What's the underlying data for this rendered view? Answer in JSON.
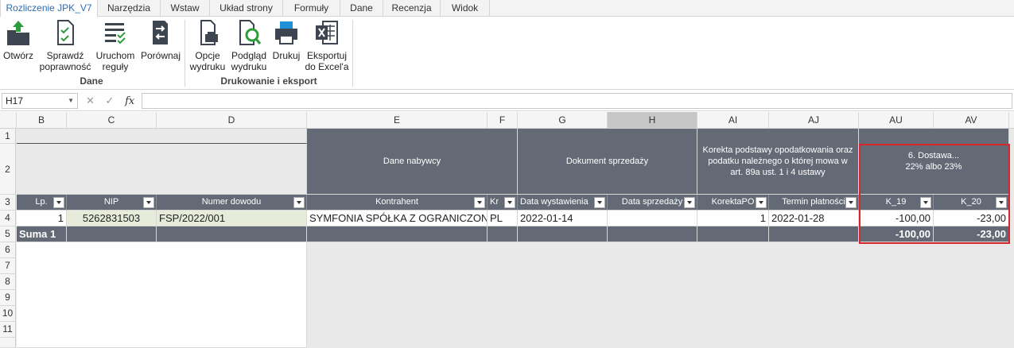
{
  "tabs": [
    {
      "label": "Rozliczenie JPK_V7",
      "active": true
    },
    {
      "label": "Narzędzia"
    },
    {
      "label": "Wstaw"
    },
    {
      "label": "Układ strony"
    },
    {
      "label": "Formuły"
    },
    {
      "label": "Dane"
    },
    {
      "label": "Recenzja"
    },
    {
      "label": "Widok"
    }
  ],
  "ribbon": {
    "buttons": [
      {
        "line1": "Otwórz",
        "line2": "",
        "icon": "open-folder-icon"
      },
      {
        "line1": "Sprawdź",
        "line2": "poprawność",
        "icon": "check-document-icon"
      },
      {
        "line1": "Uruchom",
        "line2": "reguły",
        "icon": "rules-list-icon"
      },
      {
        "line1": "Porównaj",
        "line2": "",
        "icon": "compare-icon"
      },
      {
        "line1": "Opcje",
        "line2": "wydruku",
        "icon": "print-options-icon"
      },
      {
        "line1": "Podgląd",
        "line2": "wydruku",
        "icon": "print-preview-icon"
      },
      {
        "line1": "Drukuj",
        "line2": "",
        "icon": "printer-icon"
      },
      {
        "line1": "Eksportuj",
        "line2": "do Excel'a",
        "icon": "excel-icon"
      }
    ],
    "groups": [
      "Dane",
      "Drukowanie i eksport"
    ]
  },
  "formula_bar": {
    "name_box": "H17",
    "cancel": "✕",
    "confirm": "✓",
    "fx": "fx",
    "value": ""
  },
  "columns": [
    "B",
    "C",
    "D",
    "E",
    "F",
    "G",
    "H",
    "AI",
    "AJ",
    "AU",
    "AV"
  ],
  "rows": [
    "1",
    "2",
    "3",
    "4",
    "5",
    "6",
    "7",
    "8",
    "9",
    "10",
    "11"
  ],
  "band_headers": {
    "dane_nabywcy": "Dane nabywcy",
    "dokument_sprzedazy": "Dokument sprzedaży",
    "korekta": "Korekta podstawy opodatkowania oraz podatku należnego o której mowa w art. 89a ust. 1 i 4 ustawy",
    "dostawa_line1": "6. Dostawa...",
    "dostawa_line2": "22% albo 23%"
  },
  "field_headers": {
    "lp": "Lp.",
    "nip": "NIP",
    "numer": "Numer dowodu",
    "kontrahent": "Kontrahent",
    "kr": "Kr",
    "data_wyst": "Data wystawienia",
    "data_sprz": "Data sprzedaży",
    "korekta_po": "KorektaPO",
    "termin": "Termin płatności",
    "k19": "K_19",
    "k20": "K_20"
  },
  "data_row": {
    "lp": "1",
    "nip": "5262831503",
    "numer": "FSP/2022/001",
    "kontrahent": "SYMFONIA SPÓŁKA Z OGRANICZONĄ ODPOWIEDZIALNOŚCIĄ",
    "kr": "PL",
    "data_wyst": "2022-01-14",
    "data_sprz": "",
    "korekta_po": "1",
    "termin": "2022-01-28",
    "k19": "-100,00",
    "k20": "-23,00"
  },
  "sum_row": {
    "label": "Suma 1",
    "k19": "-100,00",
    "k20": "-23,00"
  },
  "colors": {
    "header_band": "#636a75",
    "highlight_border": "#d9262d",
    "nip_fill": "#e6ecd9",
    "active_tab_text": "#2b6cb0"
  }
}
